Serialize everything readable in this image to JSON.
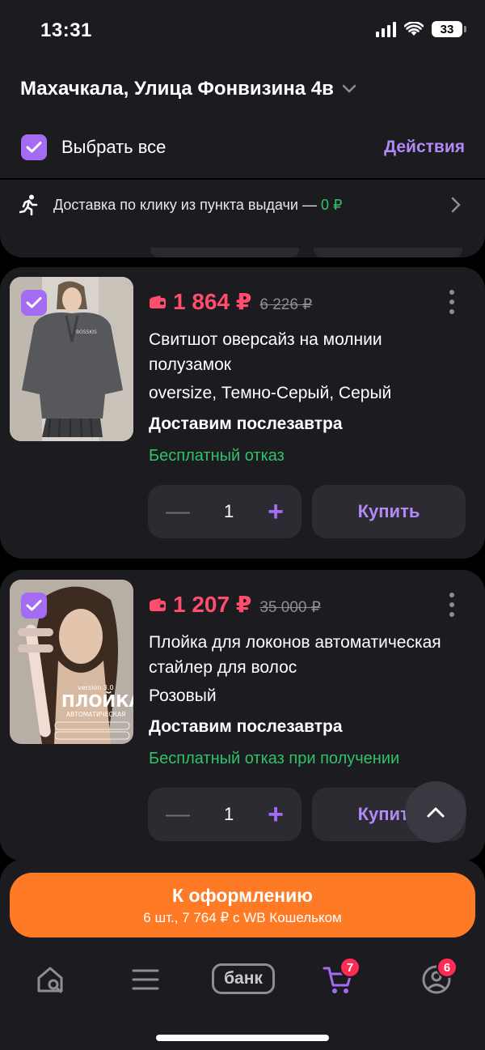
{
  "status": {
    "time": "13:31",
    "battery": "33"
  },
  "header": {
    "address": "Махачкала, Улица Фонвизина 4в",
    "select_all": "Выбрать все",
    "actions": "Действия"
  },
  "delivery_banner": {
    "text": "Доставка по клику из пункта выдачи — ",
    "price": "0 ₽"
  },
  "products": [
    {
      "price": "1 864 ₽",
      "old_price": "6 226 ₽",
      "title": "Свитшот оверсайз на молнии полузамок",
      "attributes": "oversize, Темно-Серый, Серый",
      "delivery": "Доставим послезавтра",
      "refund": "Бесплатный отказ",
      "quantity": "1",
      "buy_label": "Купить"
    },
    {
      "price": "1 207 ₽",
      "old_price": "35 000 ₽",
      "title": "Плойка для локонов автоматическая стайлер для волос",
      "attributes": "Розовый",
      "delivery": "Доставим послезавтра",
      "refund": "Бесплатный отказ при получении",
      "quantity": "1",
      "buy_label": "Купить",
      "image_text": {
        "version": "version 3.0",
        "name": "ПЛОЙКА",
        "sub": "АВТОМАТИЧЕСКАЯ"
      }
    }
  ],
  "checkout": {
    "title": "К оформлению",
    "subtitle": "6 шт., 7 764 ₽ с WB Кошельком"
  },
  "tabbar": {
    "bank_label": "банк",
    "cart_badge": "7",
    "profile_badge": "6"
  },
  "colors": {
    "accent": "#a36cf3",
    "price": "#ff4d6d",
    "success": "#2fc26b",
    "checkout": "#ff7a25"
  }
}
